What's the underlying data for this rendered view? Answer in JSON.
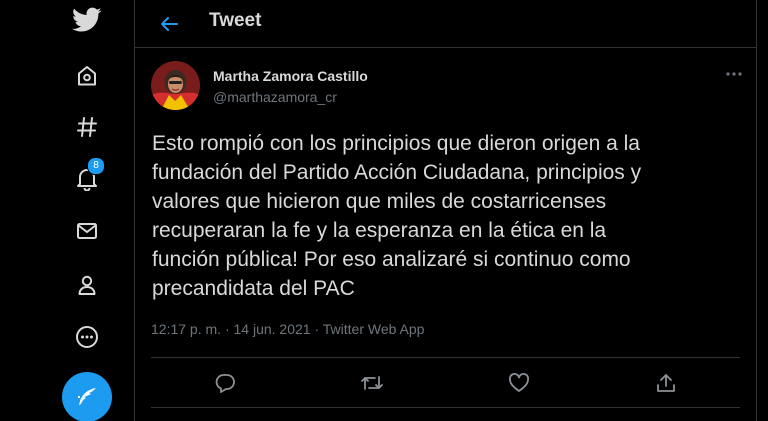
{
  "nav": {
    "items": [
      {
        "icon": "twitter-logo-icon"
      },
      {
        "icon": "home-icon"
      },
      {
        "icon": "explore-hashtag-icon"
      },
      {
        "icon": "notifications-bell-icon",
        "badge": "8"
      },
      {
        "icon": "messages-envelope-icon"
      },
      {
        "icon": "profile-icon"
      },
      {
        "icon": "more-circle-icon"
      }
    ],
    "compose_icon": "compose-tweet-icon"
  },
  "header": {
    "back_icon": "back-arrow-icon",
    "title": "Tweet"
  },
  "tweet": {
    "author_name": "Martha Zamora Castillo",
    "author_handle": "@marthazamora_cr",
    "more_icon": "more-horizontal-icon",
    "text": "Esto rompió con los principios que dieron origen a la\nfundación del Partido Acción Ciudadana,  principios y\nvalores que hicieron que miles de costarricenses\nrecuperaran la fe y la esperanza en la ética en la\nfunción pública! Por eso analizaré si continuo como\nprecandidata del PAC",
    "time": "12:17 p. m.",
    "separator": "·",
    "date": "14 jun. 2021",
    "source": "Twitter Web App"
  },
  "actions": {
    "icons": [
      "reply-icon",
      "retweet-icon",
      "like-heart-icon",
      "share-icon"
    ]
  },
  "colors": {
    "background": "#000000",
    "accent": "#1d9bf0",
    "text": "#d9d9d9",
    "secondary_text": "#6e767d",
    "border": "#2f3336"
  }
}
